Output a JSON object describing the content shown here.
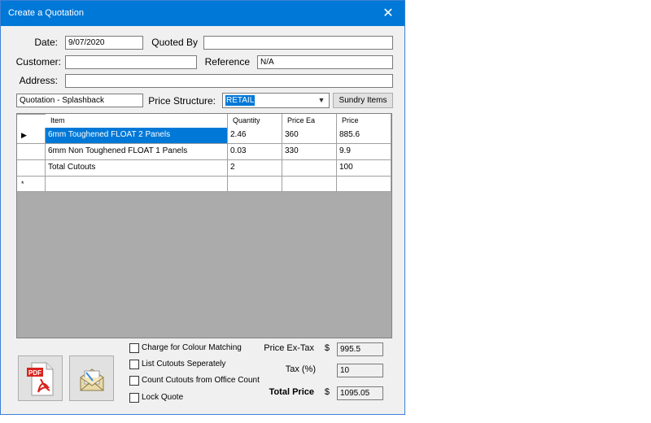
{
  "window": {
    "title": "Create a Quotation",
    "close_glyph": "✕"
  },
  "form": {
    "date_label": "Date:",
    "date_value": "9/07/2020",
    "quoted_by_label": "Quoted By",
    "quoted_by_value": "",
    "customer_label": "Customer:",
    "customer_value": "",
    "reference_label": "Reference",
    "reference_value": "N/A",
    "address_label": "Address:",
    "address_value": "",
    "quotation_name": "Quotation - Splashback",
    "price_structure_label": "Price Structure:",
    "price_structure_value": "RETAIL",
    "sundry_button": "Sundry Items"
  },
  "grid": {
    "columns": [
      "Item",
      "Quantity",
      "Price Ea",
      "Price"
    ],
    "rows": [
      {
        "indicator": "▶",
        "item": "6mm Toughened FLOAT 2 Panels",
        "quantity": "2.46",
        "price_ea": "360",
        "price": "885.6"
      },
      {
        "indicator": "",
        "item": "6mm Non Toughened FLOAT 1 Panels",
        "quantity": "0.03",
        "price_ea": "330",
        "price": "9.9"
      },
      {
        "indicator": "",
        "item": "Total Cutouts",
        "quantity": "2",
        "price_ea": "",
        "price": "100"
      },
      {
        "indicator": "*",
        "item": "",
        "quantity": "",
        "price_ea": "",
        "price": ""
      }
    ]
  },
  "options": [
    {
      "label": "Charge for Colour Matching",
      "checked": false
    },
    {
      "label": "List Cutouts Seperately",
      "checked": false
    },
    {
      "label": "Count Cutouts from Office Count",
      "checked": false
    },
    {
      "label": "Lock Quote",
      "checked": false
    }
  ],
  "totals": {
    "ex_tax_label": "Price Ex-Tax",
    "currency": "$",
    "ex_tax_value": "995.5",
    "tax_label": "Tax (%)",
    "tax_value": "10",
    "total_label": "Total Price",
    "total_value": "1095.05"
  },
  "buttons": {
    "pdf_text": "PDF",
    "pdf_icon": "pdf-icon",
    "email_icon": "envelope-icon"
  },
  "colors": {
    "titlebar": "#0078d7",
    "selection": "#0078d7",
    "pdf_red": "#d9231d",
    "grid_bg": "#ababab"
  }
}
